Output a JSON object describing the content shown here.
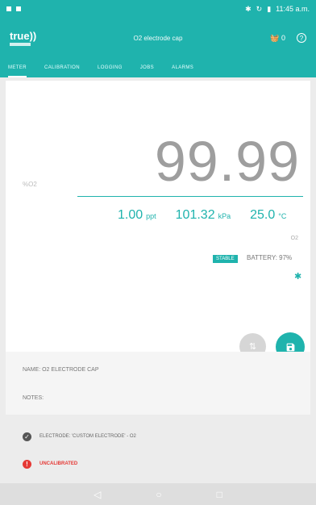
{
  "status": {
    "time": "11:45 a.m."
  },
  "app": {
    "logo": "true",
    "title": "O2 electrode cap",
    "cart_count": "0",
    "help": "?"
  },
  "tabs": [
    "METER",
    "CALIBRATION",
    "LOGGING",
    "JOBS",
    "ALARMS"
  ],
  "meter": {
    "primary_label": "%O2",
    "primary_value": "99.99",
    "secondary": [
      {
        "value": "1.00",
        "unit": "ppt"
      },
      {
        "value": "101.32",
        "unit": "kPa"
      },
      {
        "value": "25.0",
        "unit": "°C"
      }
    ],
    "sub_label": "O2",
    "stable_badge": "STABLE",
    "battery": "BATTERY: 97%"
  },
  "details": {
    "name": "NAME: O2 ELECTRODE CAP",
    "notes": "NOTES:"
  },
  "status_rows": [
    {
      "icon": "check-icon",
      "text": "ELECTRODE: 'CUSTOM ELECTRODE' - O2"
    },
    {
      "icon": "error-icon",
      "text": "UNCALIBRATED"
    }
  ],
  "colors": {
    "accent": "#1fb3ad",
    "error": "#e53935"
  }
}
